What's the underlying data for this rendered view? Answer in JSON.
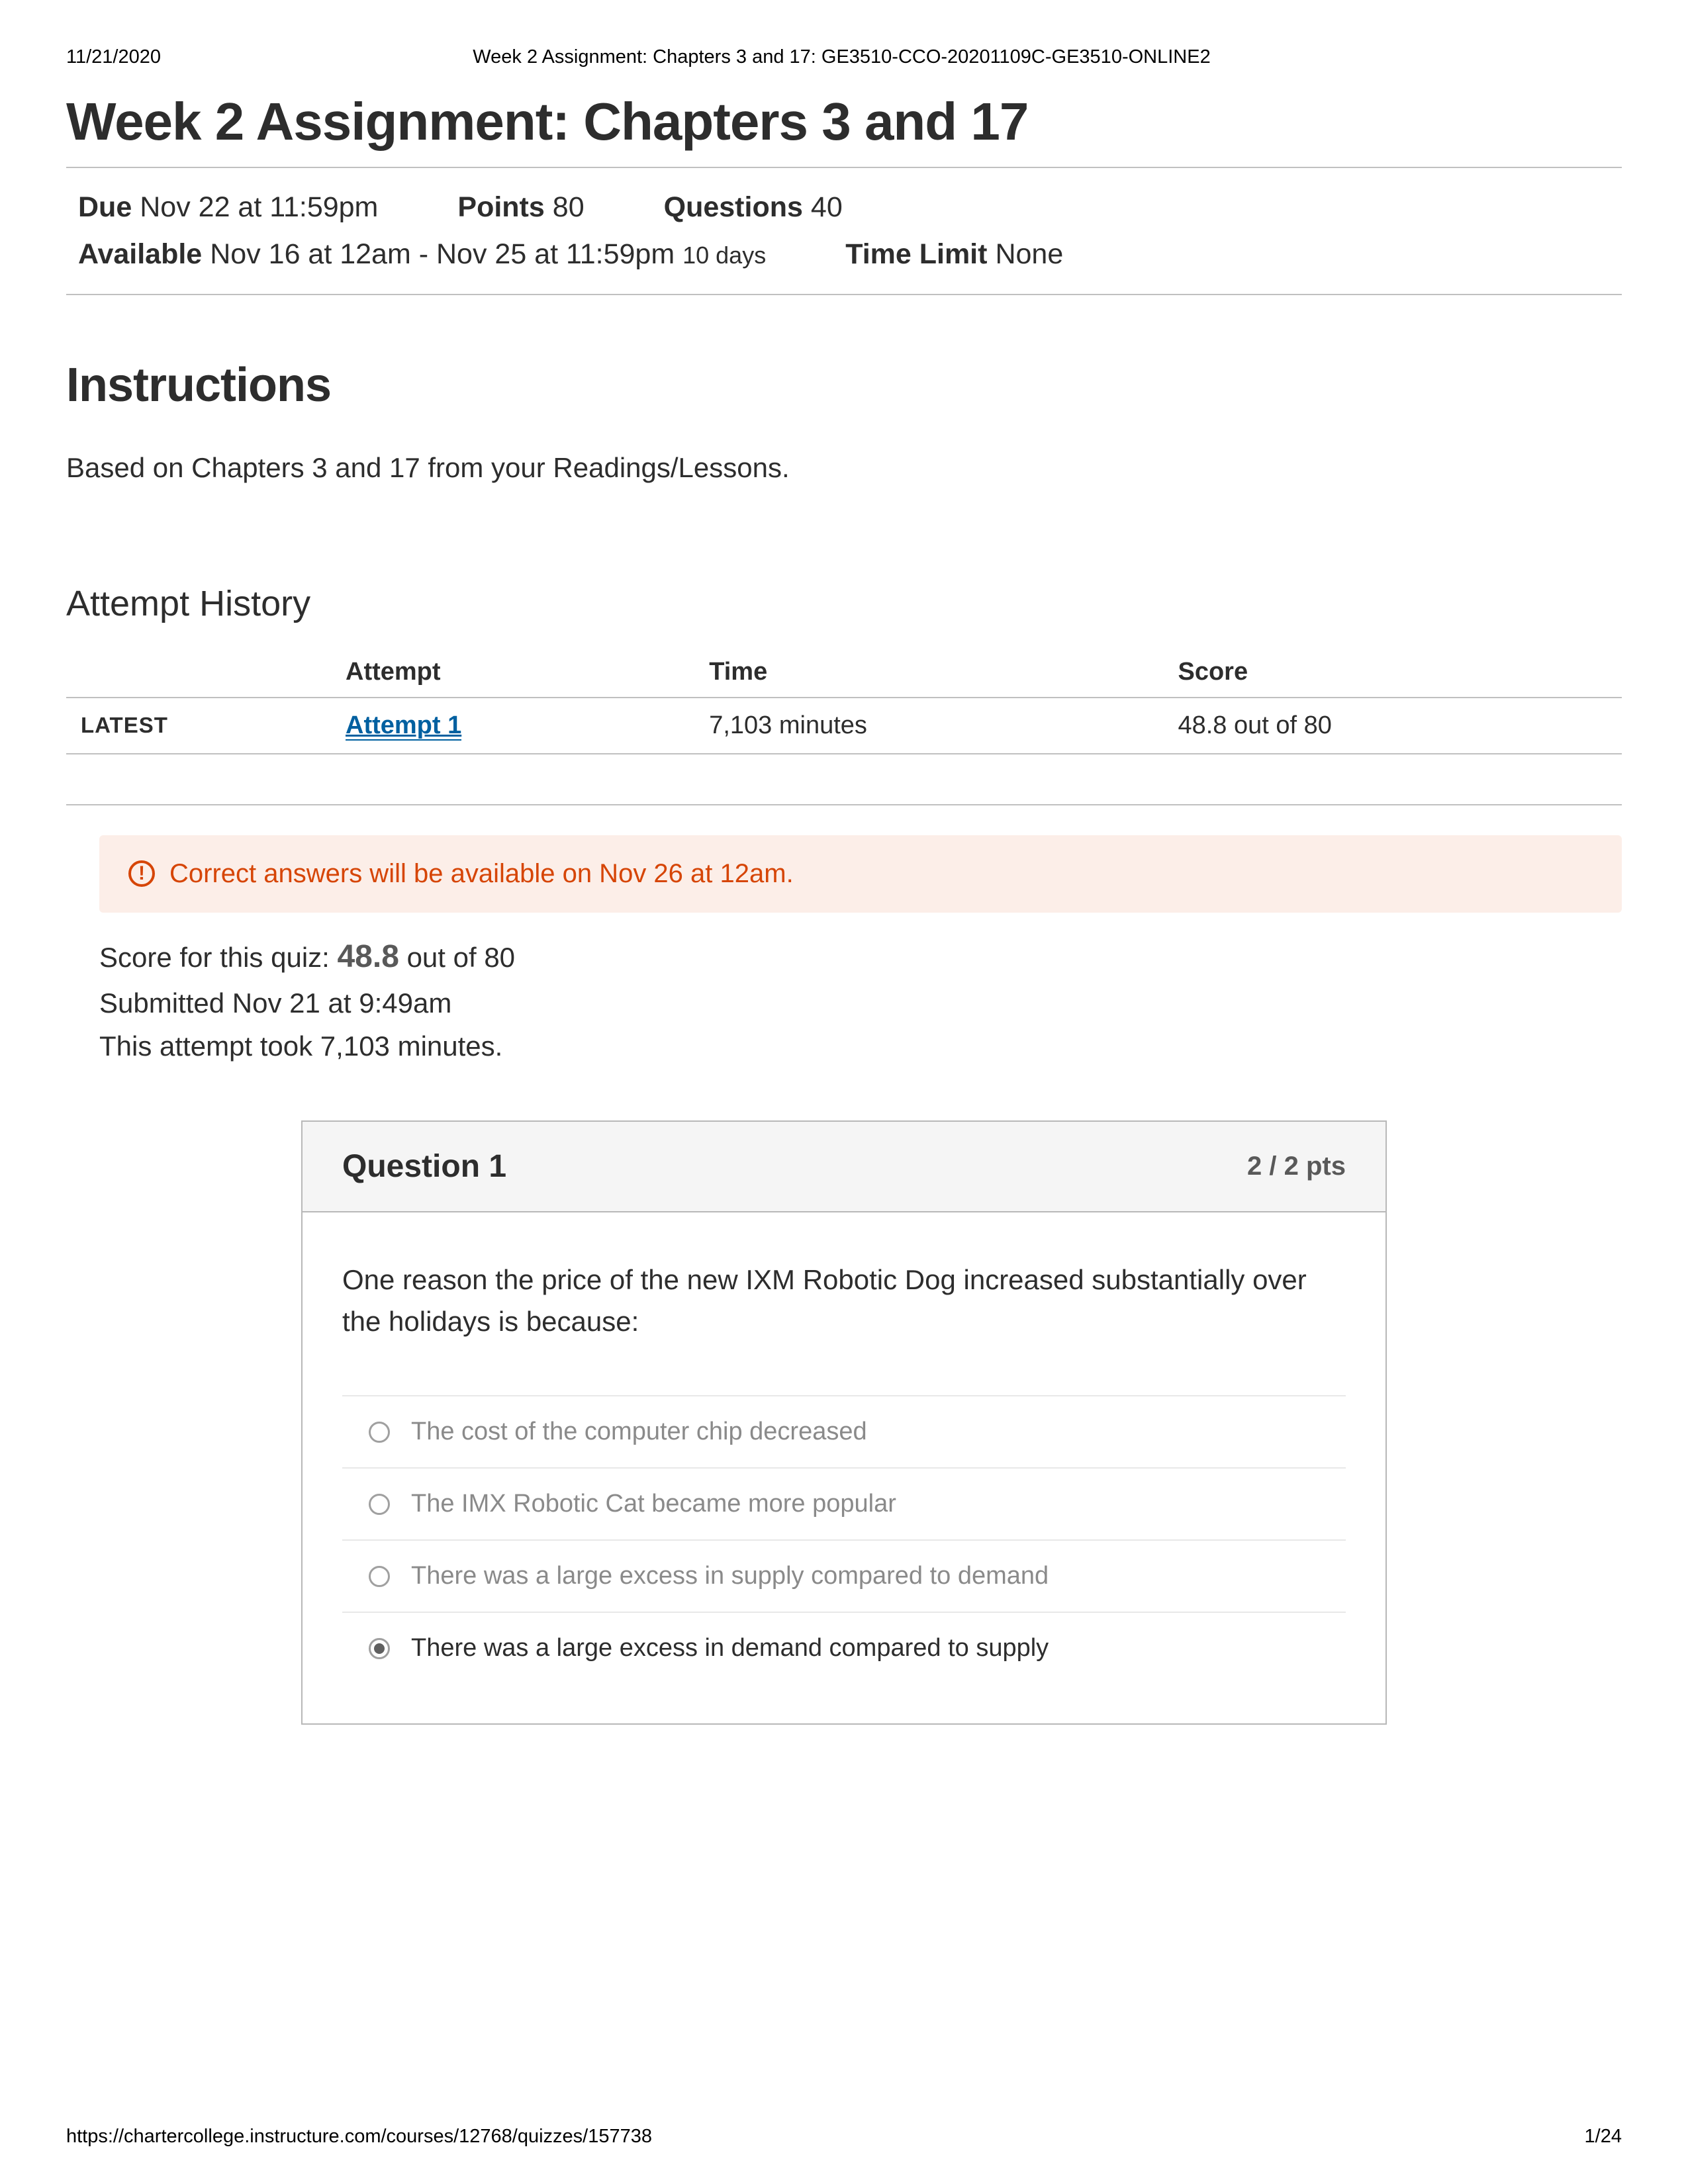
{
  "print": {
    "date": "11/21/2020",
    "doc_title": "Week 2 Assignment: Chapters 3 and 17: GE3510-CCO-20201109C-GE3510-ONLINE2",
    "footer_url": "https://chartercollege.instructure.com/courses/12768/quizzes/157738",
    "page_indicator": "1/24"
  },
  "page_title": "Week 2 Assignment: Chapters 3 and 17",
  "meta": {
    "due_label": "Due",
    "due_value": "Nov 22 at 11:59pm",
    "points_label": "Points",
    "points_value": "80",
    "questions_label": "Questions",
    "questions_value": "40",
    "available_label": "Available",
    "available_value": "Nov 16 at 12am - Nov 25 at 11:59pm",
    "available_duration": "10 days",
    "timelimit_label": "Time Limit",
    "timelimit_value": "None"
  },
  "instructions": {
    "heading": "Instructions",
    "body": "Based on Chapters 3 and 17 from your Readings/Lessons."
  },
  "history": {
    "heading": "Attempt History",
    "col_attempt": "Attempt",
    "col_time": "Time",
    "col_score": "Score",
    "latest_label": "LATEST",
    "attempt_link": "Attempt 1",
    "time_value": "7,103 minutes",
    "score_value": "48.8 out of 80"
  },
  "notice": {
    "text": "Correct answers will be available on Nov 26 at 12am."
  },
  "result": {
    "score_prefix": "Score for this quiz: ",
    "score_big": "48.8",
    "score_suffix": " out of 80",
    "submitted": "Submitted Nov 21 at 9:49am",
    "duration": "This attempt took 7,103 minutes."
  },
  "question": {
    "title": "Question 1",
    "points": "2 / 2 pts",
    "text": "One reason the price of the new IXM Robotic Dog increased substantially over the holidays is because:",
    "options": [
      {
        "label": "The cost of the computer chip decreased",
        "selected": false
      },
      {
        "label": "The IMX Robotic Cat became more popular",
        "selected": false
      },
      {
        "label": "There was a large excess in supply compared to demand",
        "selected": false
      },
      {
        "label": "There was a large excess in demand compared to supply",
        "selected": true
      }
    ]
  }
}
